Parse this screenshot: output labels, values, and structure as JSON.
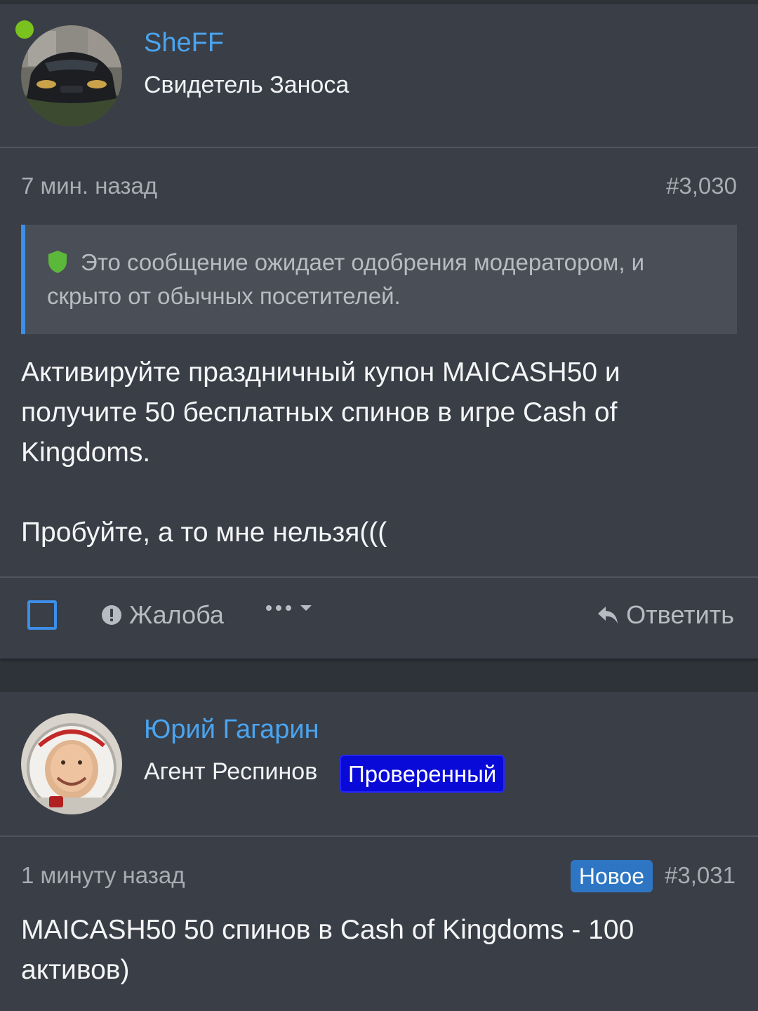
{
  "posts": [
    {
      "username": "SheFF",
      "user_title": "Свидетель Заноса",
      "online": true,
      "time": "7 мин. назад",
      "number": "#3,030",
      "moderation_notice": "Это сообщение ожидает одобрения модератором, и скрыто от обычных посетителей.",
      "message": "Активируйте праздничный купон MAICASH50 и получите 50 бесплатных спинов в игре Cash of Kingdoms.\n\nПробуйте, а то мне нельзя(((",
      "actions": {
        "report": "Жалоба",
        "more": "•••",
        "reply": "Ответить"
      }
    },
    {
      "username": "Юрий Гагарин",
      "user_title": "Агент Респинов",
      "banner": "Проверенный",
      "time": "1 минуту назад",
      "new_badge": "Новое",
      "number": "#3,031",
      "message": "MAICASH50 50 спинов в Cash of Kingdoms - 100 активов)"
    }
  ],
  "colors": {
    "accent": "#3d8ee8",
    "username": "#4aa4f0",
    "online": "#7ac21e",
    "banner": "#0a0ad8",
    "new_badge": "#2e76c4",
    "card": "#3a3e46",
    "page": "#2e3239"
  },
  "icons": {
    "shield": "shield-icon",
    "report": "exclamation-circle-icon",
    "more": "ellipsis-icon",
    "dropdown": "caret-down-icon",
    "reply": "reply-arrow-icon"
  }
}
